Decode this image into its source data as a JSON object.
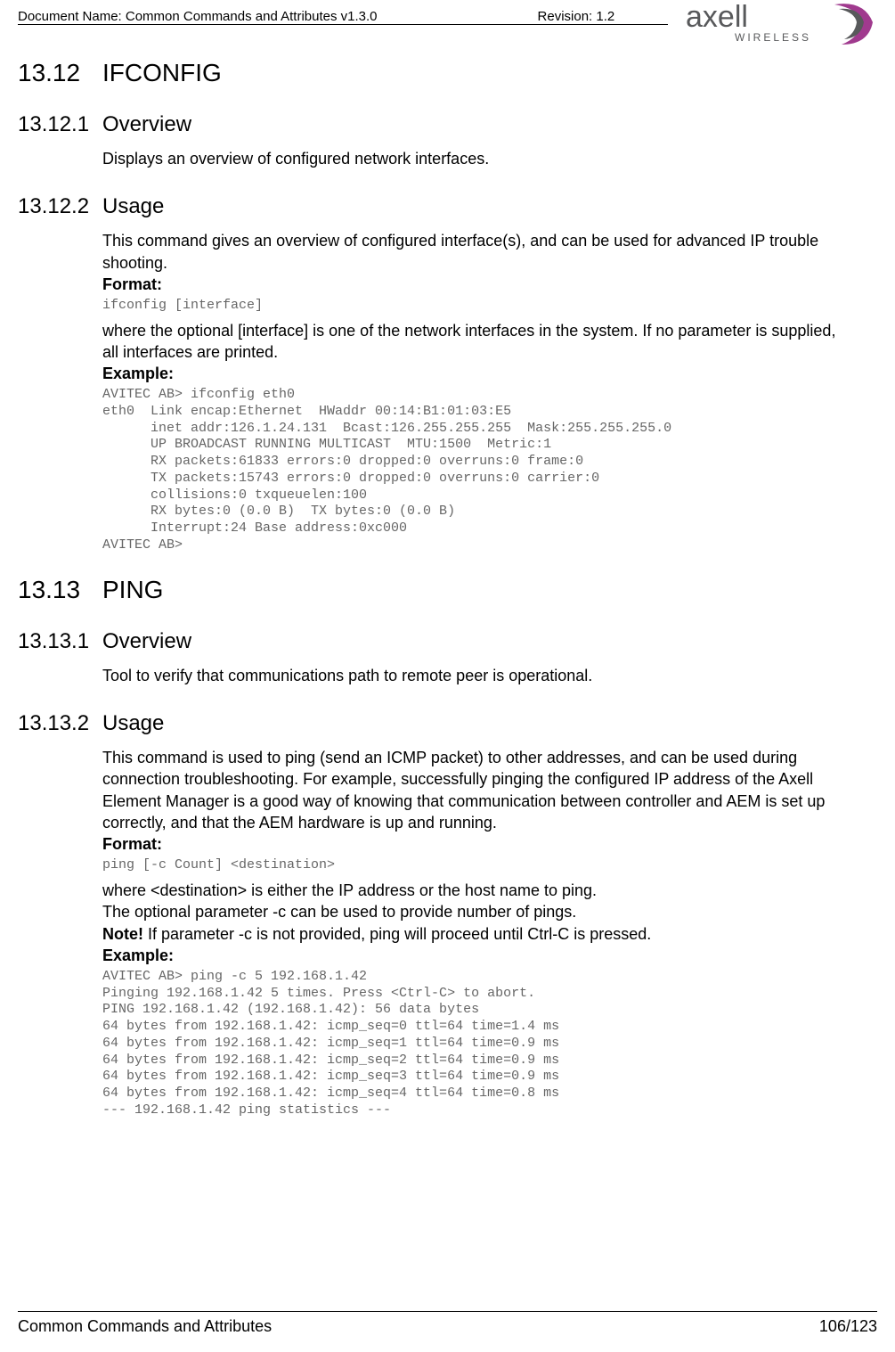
{
  "header": {
    "doc_name_label": "Document Name: Common Commands and Attributes v1.3.0",
    "revision_label": "Revision: 1.2",
    "logo_text1": "axell",
    "logo_text2": "WIRELESS"
  },
  "sec1": {
    "num": "13.12",
    "title": "IFCONFIG",
    "sub1": {
      "num": "13.12.1",
      "title": "Overview",
      "text": "Displays an overview of configured network interfaces."
    },
    "sub2": {
      "num": "13.12.2",
      "title": "Usage",
      "intro": "This command gives an overview of configured interface(s), and can be used for advanced IP trouble shooting.",
      "format_label": "Format:",
      "format_code": "ifconfig [interface]",
      "where_text": "where the optional [interface] is one of the network interfaces in the system. If no parameter is supplied, all interfaces are printed.",
      "example_label": "Example:",
      "example_code": "AVITEC AB> ifconfig eth0\neth0  Link encap:Ethernet  HWaddr 00:14:B1:01:03:E5\n      inet addr:126.1.24.131  Bcast:126.255.255.255  Mask:255.255.255.0\n      UP BROADCAST RUNNING MULTICAST  MTU:1500  Metric:1\n      RX packets:61833 errors:0 dropped:0 overruns:0 frame:0\n      TX packets:15743 errors:0 dropped:0 overruns:0 carrier:0\n      collisions:0 txqueuelen:100\n      RX bytes:0 (0.0 B)  TX bytes:0 (0.0 B)\n      Interrupt:24 Base address:0xc000\nAVITEC AB>"
    }
  },
  "sec2": {
    "num": "13.13",
    "title": "PING",
    "sub1": {
      "num": "13.13.1",
      "title": "Overview",
      "text": "Tool to verify that communications path to remote peer is operational."
    },
    "sub2": {
      "num": "13.13.2",
      "title": "Usage",
      "intro": "This command is used to ping (send an ICMP packet) to other addresses, and can be used during connection troubleshooting. For example, successfully pinging the configured IP address of the Axell Element Manager is a good way of knowing that communication between controller and AEM is set up correctly, and that the AEM hardware is up and running.",
      "format_label": "Format:",
      "format_code": "ping [-c Count] <destination>",
      "where_text1": "where <destination> is either the IP address or the host name to ping.",
      "where_text2": "The optional parameter -c can be used to provide number of pings.",
      "note_bold": "Note!",
      "note_text": " If parameter -c is not provided, ping will proceed until Ctrl-C is pressed.",
      "example_label": "Example:",
      "example_code": "AVITEC AB> ping -c 5 192.168.1.42\nPinging 192.168.1.42 5 times. Press <Ctrl-C> to abort.\nPING 192.168.1.42 (192.168.1.42): 56 data bytes\n64 bytes from 192.168.1.42: icmp_seq=0 ttl=64 time=1.4 ms\n64 bytes from 192.168.1.42: icmp_seq=1 ttl=64 time=0.9 ms\n64 bytes from 192.168.1.42: icmp_seq=2 ttl=64 time=0.9 ms\n64 bytes from 192.168.1.42: icmp_seq=3 ttl=64 time=0.9 ms\n64 bytes from 192.168.1.42: icmp_seq=4 ttl=64 time=0.8 ms\n--- 192.168.1.42 ping statistics ---"
    }
  },
  "footer": {
    "title": "Common Commands and Attributes",
    "pagenum": "106/123"
  }
}
